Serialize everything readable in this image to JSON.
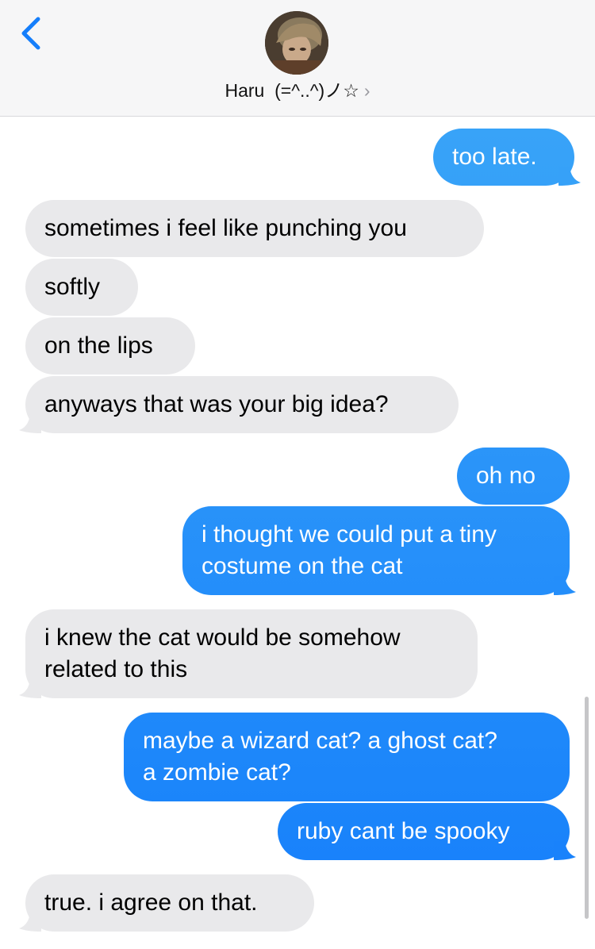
{
  "header": {
    "contact_name": "Haru  (=^..^)ノ☆",
    "chevron": "›",
    "back_icon": "chevron-left-icon",
    "accent_color": "#157efb"
  },
  "colors": {
    "incoming": "#e9e9eb",
    "outgoing_top": "#3ea9f7",
    "outgoing_bottom": "#157efb"
  },
  "messages": [
    {
      "direction": "out",
      "lines": [
        "too late."
      ]
    },
    {
      "direction": "in",
      "lines": [
        "sometimes i feel like punching you"
      ]
    },
    {
      "direction": "in",
      "lines": [
        "softly"
      ]
    },
    {
      "direction": "in",
      "lines": [
        "on the lips"
      ]
    },
    {
      "direction": "in",
      "lines": [
        "anyways that was your big idea?"
      ]
    },
    {
      "direction": "out",
      "lines": [
        "oh no"
      ]
    },
    {
      "direction": "out",
      "lines": [
        "i thought we could put a tiny",
        "costume on the cat"
      ]
    },
    {
      "direction": "in",
      "lines": [
        "i knew the cat would be somehow",
        "related to this"
      ]
    },
    {
      "direction": "out",
      "lines": [
        "maybe a wizard cat? a ghost cat?",
        "a zombie cat?"
      ]
    },
    {
      "direction": "out",
      "lines": [
        "ruby cant be spooky"
      ]
    },
    {
      "direction": "in",
      "lines": [
        "true. i agree on that."
      ]
    }
  ]
}
